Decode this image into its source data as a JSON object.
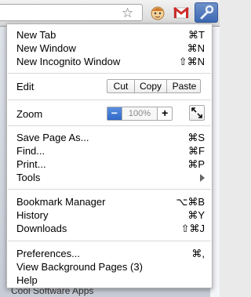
{
  "menu": {
    "group1": [
      {
        "label": "New Tab",
        "shortcut": "⌘T"
      },
      {
        "label": "New Window",
        "shortcut": "⌘N"
      },
      {
        "label": "New Incognito Window",
        "shortcut": "⇧⌘N"
      }
    ],
    "edit": {
      "label": "Edit",
      "cut": "Cut",
      "copy": "Copy",
      "paste": "Paste"
    },
    "zoom": {
      "label": "Zoom",
      "minus": "−",
      "value": "100%",
      "plus": "+"
    },
    "group3": [
      {
        "label": "Save Page As...",
        "shortcut": "⌘S"
      },
      {
        "label": "Find...",
        "shortcut": "⌘F"
      },
      {
        "label": "Print...",
        "shortcut": "⌘P"
      },
      {
        "label": "Tools",
        "shortcut": ""
      }
    ],
    "group4": [
      {
        "label": "Bookmark Manager",
        "shortcut": "⌥⌘B"
      },
      {
        "label": "History",
        "shortcut": "⌘Y"
      },
      {
        "label": "Downloads",
        "shortcut": "⇧⌘J"
      }
    ],
    "group5": [
      {
        "label": "Preferences...",
        "shortcut": "⌘,"
      },
      {
        "label": "View Background Pages (3)",
        "shortcut": ""
      },
      {
        "label": "Help",
        "shortcut": ""
      }
    ]
  },
  "background": {
    "bottom_text": "Cool Software Apps"
  },
  "icons": {
    "star": "star-icon",
    "extension": "face-extension-icon",
    "gmail": "gmail-icon",
    "wrench": "wrench-icon",
    "fullscreen": "fullscreen-icon",
    "submenu": "chevron-right-icon"
  },
  "colors": {
    "zoom_minus": "#2f68c8",
    "wrench_button": "#3c68b3",
    "gmail_red": "#cc2b2b"
  }
}
